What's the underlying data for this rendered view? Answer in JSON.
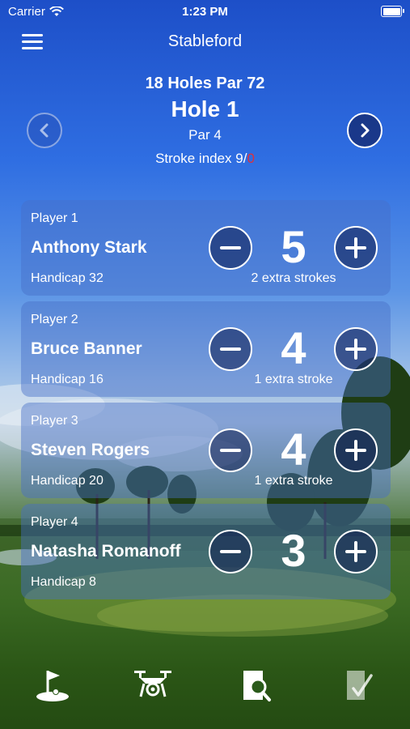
{
  "status": {
    "carrier": "Carrier",
    "time": "1:23 PM",
    "battery_level": 1.0
  },
  "nav": {
    "title": "Stableford"
  },
  "round": {
    "course": "18 Holes Par 72",
    "hole": "Hole 1",
    "par": "Par 4",
    "stroke_index_prefix": "Stroke index 9/",
    "stroke_index_suffix": "0"
  },
  "players": [
    {
      "label": "Player 1",
      "name": "Anthony Stark",
      "handicap": "Handicap 32",
      "score": "5",
      "extra": "2 extra strokes"
    },
    {
      "label": "Player 2",
      "name": "Bruce Banner",
      "handicap": "Handicap 16",
      "score": "4",
      "extra": "1 extra stroke"
    },
    {
      "label": "Player 3",
      "name": "Steven Rogers",
      "handicap": "Handicap 20",
      "score": "4",
      "extra": "1 extra stroke"
    },
    {
      "label": "Player 4",
      "name": "Natasha Romanoff",
      "handicap": "Handicap 8",
      "score": "3",
      "extra": ""
    }
  ],
  "tabs": [
    {
      "icon": "golf-flag-icon"
    },
    {
      "icon": "drone-icon"
    },
    {
      "icon": "search-document-icon"
    },
    {
      "icon": "scorecard-check-icon"
    }
  ],
  "colors": {
    "accent_red": "#e0303a",
    "card_bg": "rgba(70,110,200,0.45)"
  }
}
